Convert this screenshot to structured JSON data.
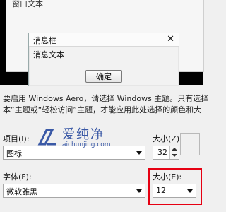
{
  "preview": {
    "window_text": "窗口文本",
    "msgbox_title": "消息框",
    "msgbox_text": "消息文本",
    "ok_label": "确定"
  },
  "description": {
    "line1": "要启用 Windows Aero，请选择 Windows 主题。只有选择",
    "line2": "本”主题或“轻松访问”主题，才能应用此处选择的颜色和大"
  },
  "item": {
    "label": "项目(I):",
    "value": "图标",
    "size_label": "大小(Z):",
    "size_value": "32"
  },
  "font": {
    "label": "字体(F):",
    "value": "微软雅黑",
    "size_label": "大小(E):",
    "size_value": "12"
  },
  "watermark": {
    "title": "爱纯净",
    "url": "aichunjing.com"
  },
  "colors": {
    "highlight": "#e60012",
    "watermark": "#1b3f9a"
  }
}
